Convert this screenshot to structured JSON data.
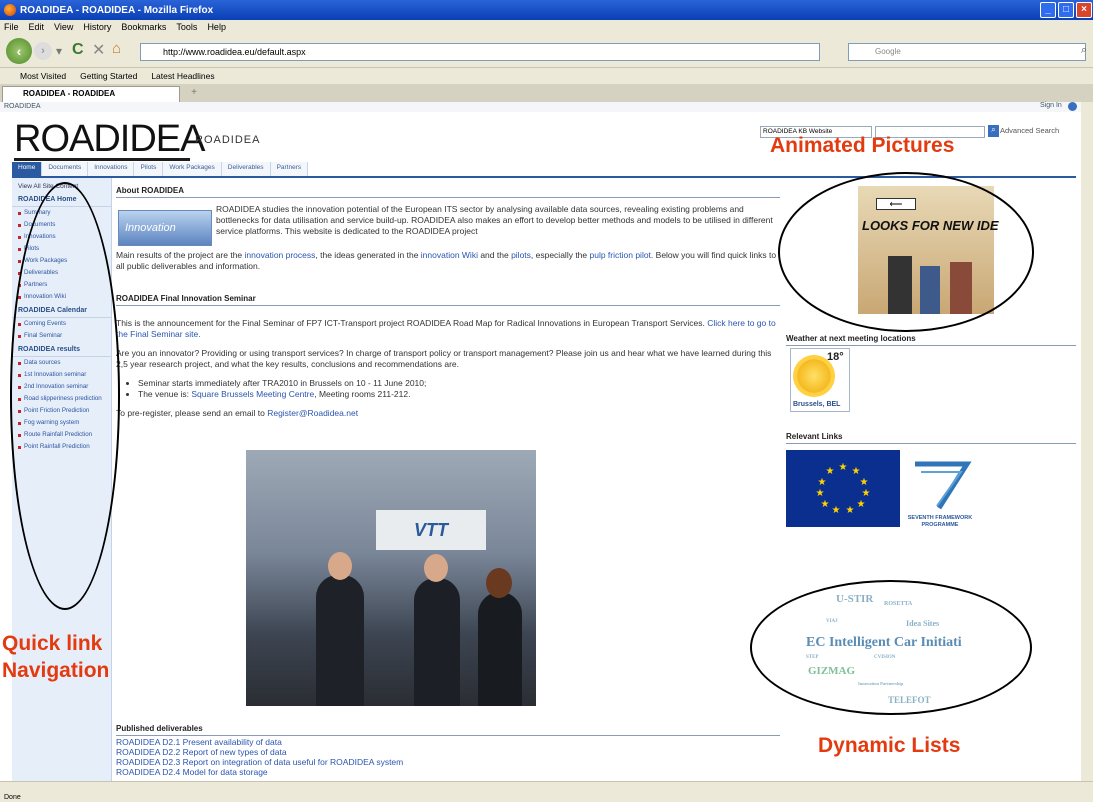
{
  "window": {
    "title": "ROADIDEA - ROADIDEA - Mozilla Firefox"
  },
  "menu": [
    "File",
    "Edit",
    "View",
    "History",
    "Bookmarks",
    "Tools",
    "Help"
  ],
  "browser": {
    "url": "http://www.roadidea.eu/default.aspx",
    "search_placeholder": "Google"
  },
  "bookmarks": [
    "Most Visited",
    "Getting Started",
    "Latest Headlines"
  ],
  "tab": {
    "label": "ROADIDEA - ROADIDEA",
    "newtab": "+"
  },
  "sp": {
    "breadcrumb": "ROADIDEA",
    "signin": "Sign In",
    "logo": "ROADIDEA",
    "logo_sub": "ROADIDEA",
    "scope": "ROADIDEA KB Website",
    "advanced": "Advanced Search",
    "topnav": [
      "Home",
      "Documents",
      "Innovations",
      "Pilots",
      "Work Packages",
      "Deliverables",
      "Partners"
    ]
  },
  "leftnav": {
    "viewall": "View All Site Content",
    "groups": [
      {
        "title": "ROADIDEA Home",
        "items": [
          "Summary",
          "Documents",
          "Innovations",
          "Pilots",
          "Work Packages",
          "Deliverables",
          "Partners",
          "Innovation Wiki"
        ]
      },
      {
        "title": "ROADIDEA Calendar",
        "items": [
          "Coming Events",
          "Final Seminar"
        ]
      },
      {
        "title": "ROADIDEA results",
        "items": [
          "Data sources",
          "1st Innovation seminar",
          "2nd Innovation seminar",
          "Road slipperiness prediction",
          "Point Friction Prediction",
          "Fog warning system",
          "Route Rainfall Prediction",
          "Point Rainfall Prediction"
        ]
      }
    ]
  },
  "main": {
    "about_title": "About ROADIDEA",
    "innov_label": "Innovation",
    "about_text": "ROADIDEA studies the innovation potential of the European ITS sector by analysing available data sources, revealing existing problems and bottlenecks for data utilisation and service build-up. ROADIDEA also makes an effort to develop better methods and models to be utilised in different service platforms. This website is dedicated to the ROADIDEA project",
    "results_a": "Main results of the project are the ",
    "results_link1": "innovation process",
    "results_b": ", the ideas generated in the ",
    "results_link2": "innovation Wiki",
    "results_c": " and the ",
    "results_link3": "pilots",
    "results_d": ", especially the ",
    "results_link4": "pulp friction pilot",
    "results_e": ". Below you will find quick links to all public deliverables and information.",
    "seminar_title": "ROADIDEA Final Innovation Seminar",
    "seminar_p1": "This is the announcement for the Final Seminar of FP7 ICT-Transport project ROADIDEA Road Map for Radical Innovations in European Transport Services. ",
    "seminar_p1_link": "Click here to go to the Final Seminar site.",
    "seminar_p2": "Are you an innovator? Providing or using transport services? In charge of transport policy or transport management? Please join us and hear what we have learned during this 2,5 year research project, and what the key results, conclusions and recommendations are.",
    "bullet1": "Seminar starts immediately after TRA2010 in Brussels on 10 - 11 June 2010;",
    "bullet2a": "The venue is: ",
    "bullet2_link": "Square Brussels Meeting Centre",
    "bullet2b": ", Meeting rooms 211-212.",
    "prereg": "To pre-register, please send an email to ",
    "prereg_link": "Register@Roadidea.net",
    "photo_sign": "VTT",
    "deliv_title": "Published deliverables",
    "deliverables": [
      "ROADIDEA D2.1 Present availability of data",
      "ROADIDEA D2.2 Report of new types of data",
      "ROADIDEA D2.3 Report on integration of data useful for ROADIDEA system",
      "ROADIDEA D2.4 Model for data storage"
    ]
  },
  "right": {
    "anim_text": "LOOKS FOR NEW IDE",
    "weather_title": "Weather at next meeting locations",
    "temp": "18°",
    "city": "Brussels, BEL",
    "links_title": "Relevant Links",
    "fp7": "SEVENTH FRAMEWORK PROGRAMME",
    "cloud": [
      "U-STIR",
      "ROSETTA",
      "VIAJ",
      "Idea Sites",
      "EC Intelligent Car Initiati",
      "STEP",
      "CVISION",
      "GIZMAG",
      "TELEFOT",
      "Innovation Partnership"
    ]
  },
  "annotations": {
    "animated": "Animated Pictures",
    "quick1": "Quick link",
    "quick2": "Navigation",
    "dynamic": "Dynamic Lists"
  },
  "status": "Done"
}
